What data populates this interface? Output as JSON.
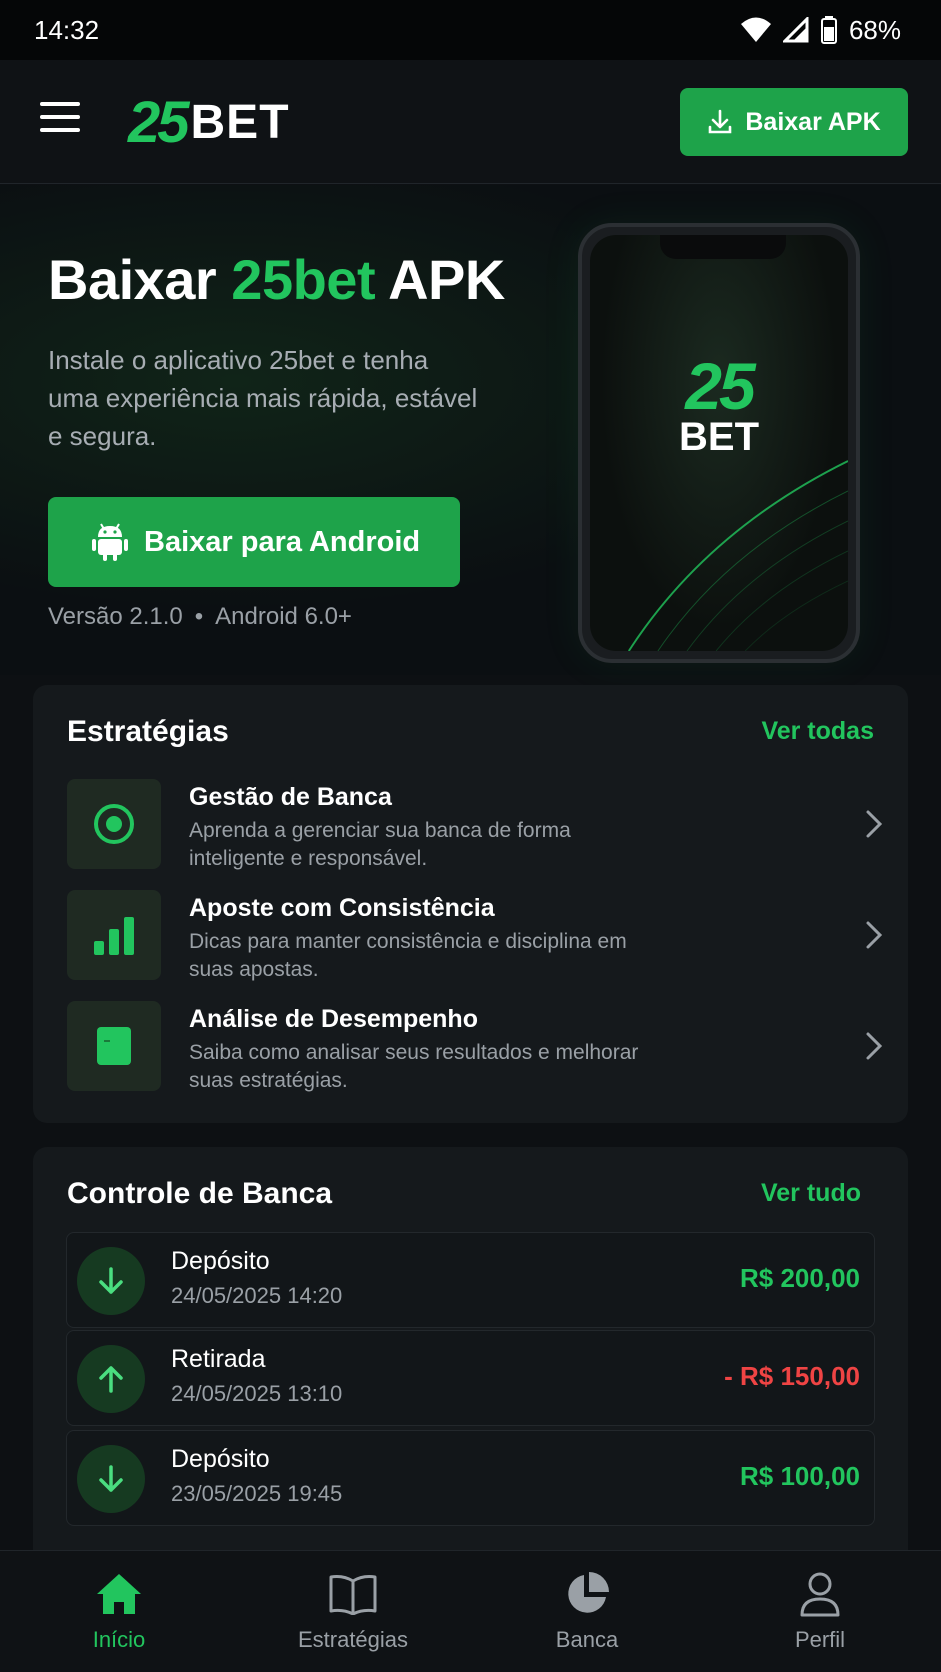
{
  "status_bar": {
    "time": "14:32",
    "battery": "68%"
  },
  "header": {
    "logo_number": "25",
    "logo_text": "BET",
    "download_button": "Baixar APK"
  },
  "hero": {
    "title_part1": "Baixar ",
    "title_accent": "25bet",
    "title_part2": " APK",
    "subtitle": "Instale o aplicativo 25bet e tenha uma experiência mais rápida, estável e segura.",
    "android_button": "Baixar para Android",
    "version": "Versão 2.1.0",
    "separator": "•",
    "android_req": "Android 6.0+",
    "phone_logo_number": "25",
    "phone_logo_text": "BET"
  },
  "strategies": {
    "title": "Estratégias",
    "link": "Ver todas",
    "items": [
      {
        "icon": "target-icon",
        "title": "Gestão de Banca",
        "desc": "Aprenda a gerenciar sua banca de forma inteligente e responsável."
      },
      {
        "icon": "bar-chart-icon",
        "title": "Aposte com Consistência",
        "desc": "Dicas para manter consistência e disciplina em suas apostas."
      },
      {
        "icon": "document-icon",
        "title": "Análise de Desempenho",
        "desc": "Saiba como analisar seus resultados e melhorar suas estratégias."
      }
    ]
  },
  "bank": {
    "title": "Controle de Banca",
    "link": "Ver tudo",
    "transactions": [
      {
        "type": "Depósito",
        "date": "24/05/2025 14:20",
        "amount": "R$ 200,00",
        "direction": "in"
      },
      {
        "type": "Retirada",
        "date": "24/05/2025 13:10",
        "amount": "- R$ 150,00",
        "direction": "out"
      },
      {
        "type": "Depósito",
        "date": "23/05/2025 19:45",
        "amount": "R$ 100,00",
        "direction": "in"
      }
    ]
  },
  "nav": {
    "items": [
      {
        "label": "Início",
        "icon": "home-icon",
        "active": true
      },
      {
        "label": "Estratégias",
        "icon": "book-icon",
        "active": false
      },
      {
        "label": "Banca",
        "icon": "pie-chart-icon",
        "active": false
      },
      {
        "label": "Perfil",
        "icon": "user-icon",
        "active": false
      }
    ]
  },
  "colors": {
    "accent": "#22c55e",
    "button": "#1ea34a",
    "negative": "#ef4444",
    "background": "#0d1013",
    "card": "#15191c"
  }
}
